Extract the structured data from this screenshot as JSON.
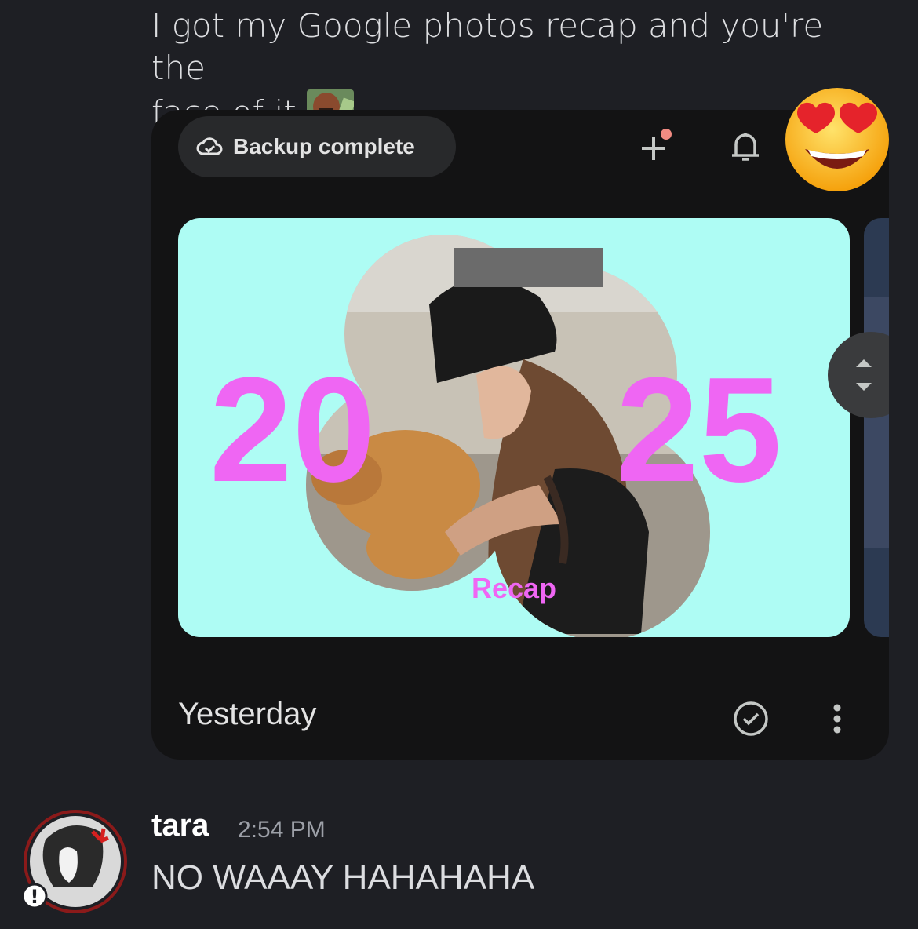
{
  "message1": {
    "text_line1": "I got my Google photos recap and you're the",
    "text_line2": "face of it",
    "inline_emoji": "custom-emoji"
  },
  "embed": {
    "backup_status": "Backup complete",
    "recap_year_left": "20",
    "recap_year_right": "25",
    "recap_label": "Recap",
    "date_label": "Yesterday",
    "icons": [
      "cloud-check-icon",
      "plus-icon",
      "bell-icon",
      "scroll-arrows-icon",
      "check-circle-icon",
      "more-vert-icon"
    ]
  },
  "reaction": {
    "emoji": "smiling-face-with-heart-eyes"
  },
  "message2": {
    "username": "tara",
    "timestamp": "2:54 PM",
    "text": "NO WAAAY HAHAHAHA"
  },
  "colors": {
    "background": "#1e1f24",
    "recap_bg": "#aefcf4",
    "recap_text": "#ef66f3",
    "notification_dot": "#f28b82"
  }
}
